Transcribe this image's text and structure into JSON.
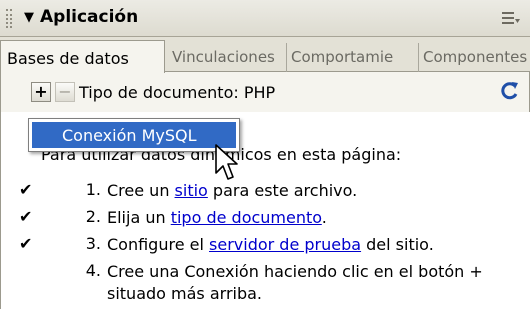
{
  "panel": {
    "title": "Aplicación",
    "collapse_glyph": "▼"
  },
  "tabs": [
    {
      "label": "Bases de datos",
      "active": true
    },
    {
      "label": "Vinculaciones",
      "active": false
    },
    {
      "label": "Comportamie",
      "active": false
    },
    {
      "label": "Componentes",
      "active": false
    }
  ],
  "toolbar": {
    "add_label": "+",
    "remove_label": "−",
    "doc_type": "Tipo de documento: PHP"
  },
  "popup": {
    "item": "Conexión MySQL"
  },
  "content": {
    "intro": "Para utilizar datos dinámicos en esta página:",
    "steps": [
      {
        "num": "1.",
        "check": "✔",
        "pre": "Cree un ",
        "link": "sitio",
        "post": " para este archivo."
      },
      {
        "num": "2.",
        "check": "✔",
        "pre": "Elija un ",
        "link": "tipo de documento",
        "post": "."
      },
      {
        "num": "3.",
        "check": "✔",
        "pre": "Configure el ",
        "link": "servidor de prueba",
        "post": " del sitio."
      },
      {
        "num": "4.",
        "check": "",
        "text": "Cree una Conexión haciendo clic en el botón + situado más arriba."
      }
    ]
  },
  "colors": {
    "link": "#0000cc",
    "popup_highlight": "#316ac5",
    "refresh": "#1f4fa8"
  },
  "icons": [
    "panel-grip-icon",
    "options-menu-icon",
    "refresh-icon",
    "mouse-pointer-icon",
    "checkmark-icon"
  ]
}
